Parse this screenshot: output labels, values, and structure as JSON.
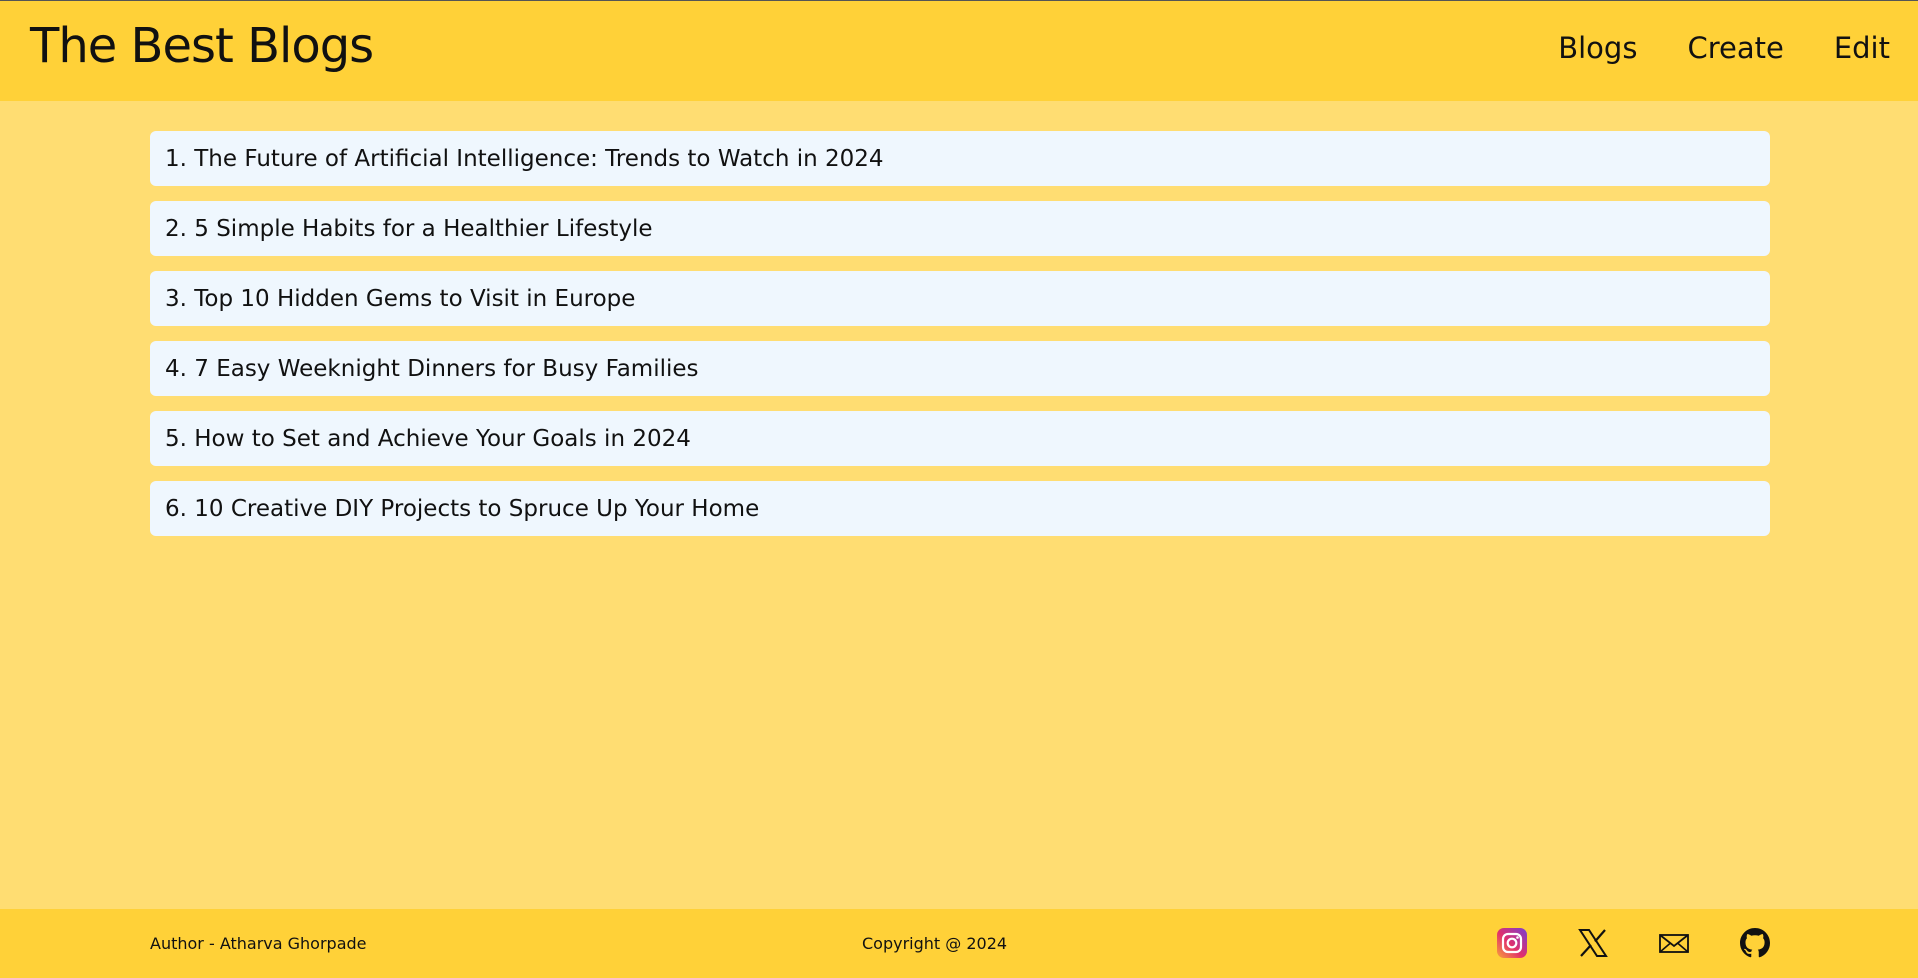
{
  "header": {
    "title": "The Best Blogs",
    "nav": [
      {
        "label": "Blogs"
      },
      {
        "label": "Create"
      },
      {
        "label": "Edit"
      }
    ]
  },
  "blogs": [
    {
      "label": "1. The Future of Artificial Intelligence: Trends to Watch in 2024"
    },
    {
      "label": "2. 5 Simple Habits for a Healthier Lifestyle"
    },
    {
      "label": "3. Top 10 Hidden Gems to Visit in Europe"
    },
    {
      "label": "4. 7 Easy Weeknight Dinners for Busy Families"
    },
    {
      "label": "5. How to Set and Achieve Your Goals in 2024"
    },
    {
      "label": "6. 10 Creative DIY Projects to Spruce Up Your Home"
    }
  ],
  "footer": {
    "author": "Author - Atharva Ghorpade",
    "copyright": "Copyright @ 2024",
    "socials": [
      "instagram-icon",
      "x-icon",
      "mail-icon",
      "github-icon"
    ]
  },
  "colors": {
    "header_bg": "#ffd138",
    "page_bg": "#ffdd72",
    "card_bg": "#eff7fe",
    "text": "#111111"
  }
}
